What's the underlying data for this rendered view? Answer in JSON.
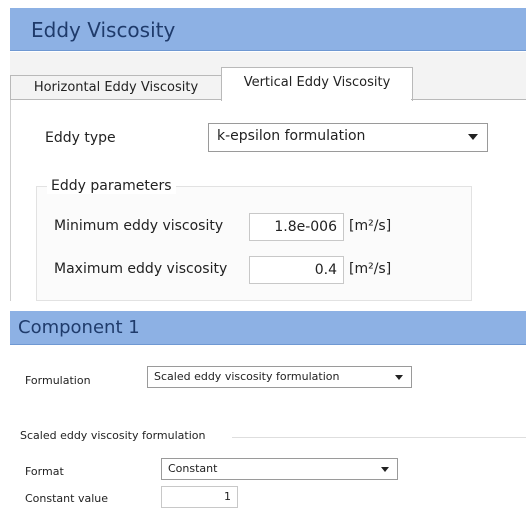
{
  "header": {
    "title": "Eddy Viscosity"
  },
  "tabs": [
    {
      "label": "Horizontal Eddy Viscosity",
      "active": false
    },
    {
      "label": "Vertical Eddy Viscosity",
      "active": true
    }
  ],
  "vertical": {
    "eddy_type_label": "Eddy type",
    "eddy_type_value": "k-epsilon formulation",
    "params_title": "Eddy parameters",
    "min_label": "Minimum eddy viscosity",
    "min_value": "1.8e-006",
    "min_unit": "[m²/s]",
    "max_label": "Maximum eddy viscosity",
    "max_value": "0.4",
    "max_unit": "[m²/s]"
  },
  "component": {
    "title": "Component 1",
    "formulation_label": "Formulation",
    "formulation_value": "Scaled eddy viscosity formulation",
    "section_title": "Scaled eddy viscosity formulation",
    "format_label": "Format",
    "format_value": "Constant",
    "constant_label": "Constant value",
    "constant_value": "1"
  },
  "colors": {
    "header_bg": "#8db1e4",
    "header_text": "#1f3b6b"
  }
}
